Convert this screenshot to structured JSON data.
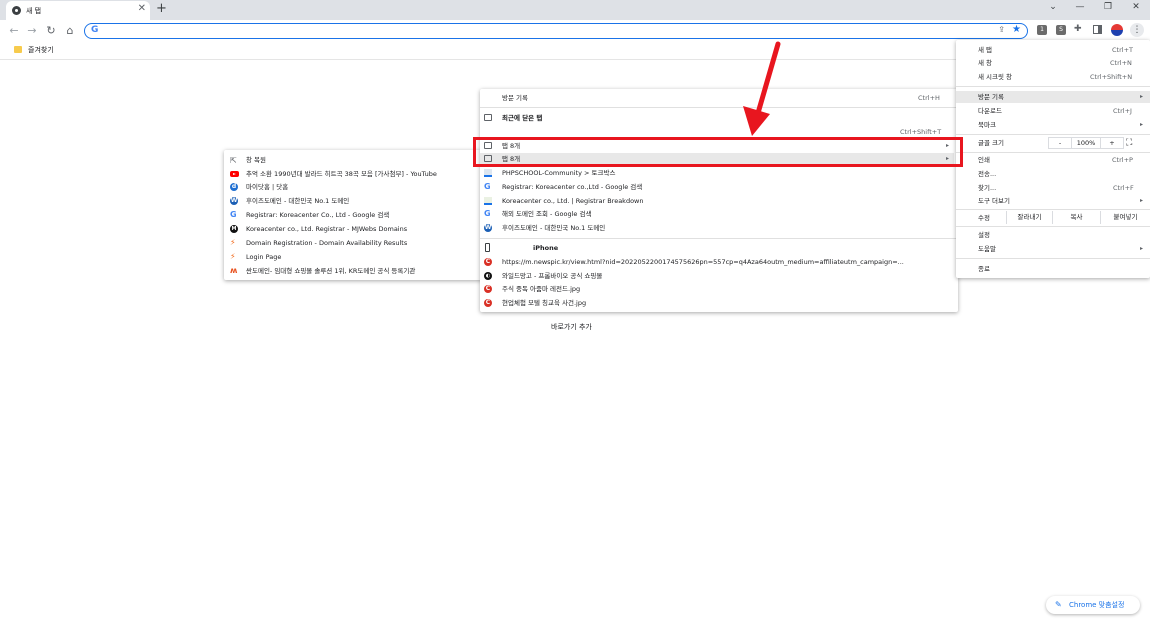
{
  "tab": {
    "title": "새 탭",
    "close": "✕",
    "new": "+"
  },
  "window": {
    "chevron": "⌄",
    "minimize": "—",
    "restore": "❐",
    "close": "✕"
  },
  "toolbar": {
    "back": "←",
    "forward": "→",
    "reload": "↻",
    "home": "⌂",
    "omnibox_value": "",
    "g_logo": "G",
    "ext1": "1",
    "ext2": "S",
    "menu": "⋮"
  },
  "bookmarks": {
    "folder_label": "즐겨찾기"
  },
  "main_menu": {
    "new_tab": "새 탭",
    "new_tab_sc": "Ctrl+T",
    "new_window": "새 창",
    "new_window_sc": "Ctrl+N",
    "incognito": "새 시크릿 창",
    "incognito_sc": "Ctrl+Shift+N",
    "history": "방문 기록",
    "downloads": "다운로드",
    "downloads_sc": "Ctrl+J",
    "bookmarks": "북마크",
    "zoom_label": "글꼴 크기",
    "zoom_minus": "-",
    "zoom_value": "100%",
    "zoom_plus": "+",
    "fullscreen": "⛶",
    "print": "인쇄",
    "print_sc": "Ctrl+P",
    "cast": "전송...",
    "find": "찾기...",
    "find_sc": "Ctrl+F",
    "more_tools": "도구 더보기",
    "edit": "수정",
    "cut": "잘라내기",
    "copy": "복사",
    "paste": "붙여넣기",
    "settings": "설정",
    "help": "도움말",
    "exit": "종료"
  },
  "history_menu": {
    "history": "방문 기록",
    "history_sc": "Ctrl+H",
    "recently_closed": "최근에 닫은 탭",
    "recently_closed_sc": "Ctrl+Shift+T",
    "tabs1": "탭 8개",
    "tabs2": "탭 8개",
    "items": [
      "PHPSCHOOL-Community > 토크박스",
      "Registrar: Koreacenter co.,Ltd - Google 검색",
      "Koreacenter co., Ltd. | Registrar Breakdown",
      "해외 도메인 조회 - Google 검색",
      "후이즈도메인 - 대한민국 No.1 도메인"
    ],
    "device": "iPhone",
    "device_items": [
      "https://m.newspic.kr/view.html?nid=2022052200174575626pn=557cp=q4Aza64outm_medium=affiliateutm_campaign=...",
      "와일드망고 - 프롬바이오 공식 쇼핑몰",
      "주식 중독 아줌마 레전드.jpg",
      "현업체험 모텔 칭교육 사건.jpg"
    ]
  },
  "sub_menu": {
    "restore": "창 복원",
    "items": [
      "추억 소환 1990년대 발라드 히트곡 38곡 모음 [가사첨부] - YouTube",
      "마이닷홈 | 닷홈",
      "후이즈도메인 - 대한민국 No.1 도메인",
      "Registrar: Koreacenter Co., Ltd - Google 검색",
      "Koreacenter co., Ltd. Registrar - MJWebs Domains",
      "Domain Registration - Domain Availability Results",
      "Login Page",
      "싼도메인- 임대형 쇼핑몰 솔루션 1위, KR도메인 공식 등록기관"
    ]
  },
  "ntp": {
    "add_shortcut": "바로가기 추가",
    "customize": "Chrome 맞춤설정",
    "pen": "✎"
  },
  "colors": {
    "highlight_box": "#e8161f",
    "accent": "#1a73e8"
  },
  "icons": {
    "star": "★",
    "share": "⇪",
    "arrow_right": "▸"
  }
}
